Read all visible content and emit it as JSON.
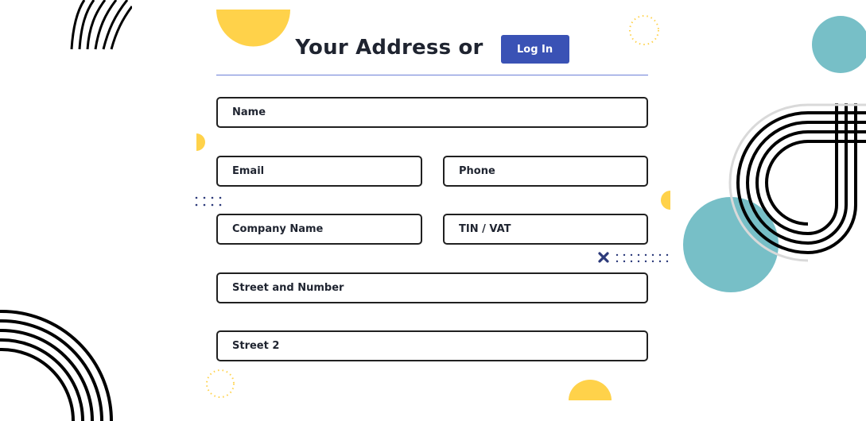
{
  "form": {
    "title": "Your Address or",
    "login_label": "Log In",
    "fields": {
      "name": {
        "placeholder": "Name",
        "value": ""
      },
      "email": {
        "placeholder": "Email",
        "value": ""
      },
      "phone": {
        "placeholder": "Phone",
        "value": ""
      },
      "company": {
        "placeholder": "Company Name",
        "value": ""
      },
      "tin": {
        "placeholder": "TIN / VAT",
        "value": ""
      },
      "street": {
        "placeholder": "Street and Number",
        "value": ""
      },
      "street2": {
        "placeholder": "Street 2",
        "value": ""
      }
    }
  },
  "colors": {
    "accent": "#3a52b5",
    "divider": "#6c7fd8",
    "yellow": "#ffd24a",
    "teal": "#77bfc7",
    "navy": "#2c3a7a",
    "border": "#202020"
  }
}
